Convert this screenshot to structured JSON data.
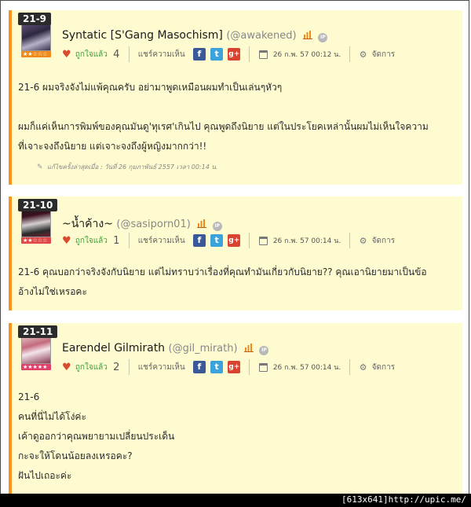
{
  "posts": [
    {
      "number": "21-9",
      "username": "Syntatic [S'Gang Masochism]",
      "handle": "(@awakened)",
      "rank_stars": "★★☆☆☆",
      "like_label": "ถูกใจแล้ว",
      "like_count": "4",
      "share_label": "แชร์ความเห็น",
      "date": "26 ก.พ. 57 00:12 น.",
      "manage_label": "จัดการ",
      "lines": [
        "21-6 ผมจริงจังไม่แพ้คุณครับ อย่ามาพูดเหมือนผมทำเป็นเล่นๆหัวๆ",
        "",
        "ผมก็แค่เห็นการพิมพ์ของคุณมันดู'ทุเรศ'เกินไป คุณพูดถึงนิยาย แต่ในประโยคเหล่านั้นผมไม่เห็นใจความ",
        "ที่เจาะจงถึงนิยาย แต่เจาะจงถึงผู้หญิงมากกว่า!!"
      ],
      "edited": "แก้ไขครั้งล่าสุดเมื่อ : วันที่ 26 กุมภาพันธ์ 2557 เวลา 00:14 น."
    },
    {
      "number": "21-10",
      "username": "~น้ำค้าง~",
      "handle": "(@sasiporn01)",
      "rank_stars": "★★☆☆☆",
      "like_label": "ถูกใจแล้ว",
      "like_count": "1",
      "share_label": "แชร์ความเห็น",
      "date": "26 ก.พ. 57 00:14 น.",
      "manage_label": "จัดการ",
      "lines": [
        "21-6 คุณบอกว่าจริงจังกับนิยาย แต่ไม่ทราบว่าเรื่องที่คุณทำมันเกี่ยวกับนิยาย?? คุณเอานิยายมาเป็นข้อ",
        "อ้างไม่ใช่เหรอคะ"
      ]
    },
    {
      "number": "21-11",
      "username": "Earendel Gilmirath",
      "handle": "(@gil_mirath)",
      "rank_stars": "★★★★★",
      "like_label": "ถูกใจแล้ว",
      "like_count": "2",
      "share_label": "แชร์ความเห็น",
      "date": "26 ก.พ. 57 00:14 น.",
      "manage_label": "จัดการ",
      "lines": [
        "21-6",
        "คนที่นี่ไม่ได้โง่ค่ะ",
        "เค้าดูออกว่าคุณพยายามเปลี่ยนประเด็น",
        "กะจะให้โดนน้อยลงเหรอคะ?",
        "ฝันไปเถอะค่ะ"
      ]
    }
  ],
  "icons": {
    "heart": "heart-icon",
    "facebook": "f",
    "twitter": "t",
    "googleplus": "g+",
    "ip": "IP",
    "gear": "⚙",
    "pencil": "✎"
  },
  "footer": "[613x641]http://upic.me/"
}
